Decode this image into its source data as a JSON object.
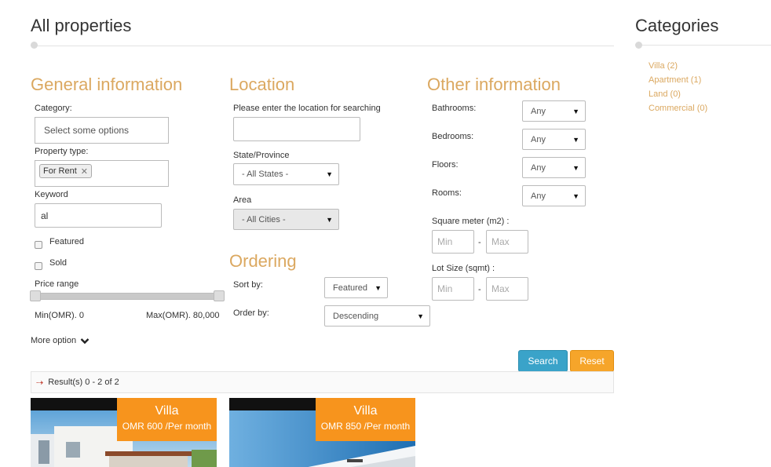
{
  "page": {
    "title": "All properties"
  },
  "general": {
    "heading": "General information",
    "category_label": "Category:",
    "category_placeholder": "Select some options",
    "property_type_label": "Property type:",
    "property_type_tag": "For Rent",
    "keyword_label": "Keyword",
    "keyword_value": "al",
    "featured_label": "Featured",
    "sold_label": "Sold",
    "price_range_label": "Price range",
    "price_min": "Min(OMR). 0",
    "price_max": "Max(OMR). 80,000",
    "more_option": "More option"
  },
  "location": {
    "heading": "Location",
    "location_label": "Please enter the location for searching",
    "state_label": "State/Province",
    "state_value": "- All States -",
    "area_label": "Area",
    "area_value": "- All Cities -"
  },
  "ordering": {
    "heading": "Ordering",
    "sort_label": "Sort by:",
    "sort_value": "Featured",
    "order_label": "Order by:",
    "order_value": "Descending"
  },
  "other": {
    "heading": "Other information",
    "bathrooms_label": "Bathrooms:",
    "bathrooms_value": "Any",
    "bedrooms_label": "Bedrooms:",
    "bedrooms_value": "Any",
    "floors_label": "Floors:",
    "floors_value": "Any",
    "rooms_label": "Rooms:",
    "rooms_value": "Any",
    "sqm_label": "Square meter (m2) :",
    "lot_label": "Lot Size (sqmt) :",
    "min_placeholder": "Min",
    "max_placeholder": "Max",
    "dash": "-"
  },
  "actions": {
    "search": "Search",
    "reset": "Reset"
  },
  "results": {
    "arrow": "⇢",
    "text": "Result(s) 0 - 2 of 2"
  },
  "listings": [
    {
      "type": "Villa",
      "price": "OMR 600 /Per month"
    },
    {
      "type": "Villa",
      "price": "OMR 850 /Per month"
    }
  ],
  "sidebar": {
    "title": "Categories",
    "items": [
      "Villa (2)",
      "Apartment (1)",
      "Land (0)",
      "Commercial (0)"
    ]
  },
  "colors": {
    "accent": "#dba860",
    "badge": "#f7941d",
    "search_btn": "#3aa3c9",
    "reset_btn": "#f6a52a"
  }
}
